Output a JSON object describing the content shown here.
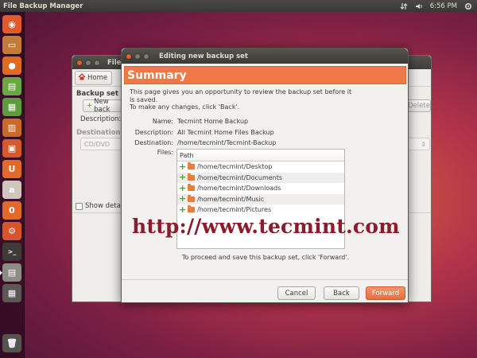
{
  "top_panel": {
    "app_title": "File Backup Manager",
    "time": "6:56 PM"
  },
  "launcher": {
    "items": [
      {
        "name": "dash-icon",
        "glyph": "◉",
        "color": "#e25a2b"
      },
      {
        "name": "files-icon",
        "glyph": "▭",
        "color": "#c47b3a"
      },
      {
        "name": "firefox-icon",
        "glyph": "●",
        "color": "#e06a1f"
      },
      {
        "name": "writer-icon",
        "glyph": "▤",
        "color": "#6aa744"
      },
      {
        "name": "calc-icon",
        "glyph": "▦",
        "color": "#5c9c3a"
      },
      {
        "name": "impress-icon",
        "glyph": "▥",
        "color": "#c96a2a"
      },
      {
        "name": "software-center-icon",
        "glyph": "▣",
        "color": "#d35a2a"
      },
      {
        "name": "ubuntu-one-icon",
        "glyph": "U",
        "color": "#e2682c"
      },
      {
        "name": "amazon-icon",
        "glyph": "a",
        "color": "#cfc7bd"
      },
      {
        "name": "ubuntu-one-music-icon",
        "glyph": "0",
        "color": "#e2682c"
      },
      {
        "name": "system-settings-icon",
        "glyph": "⚙",
        "color": "#d8552b"
      },
      {
        "name": "terminal-icon",
        "glyph": ">_",
        "color": "#3c3b37"
      },
      {
        "name": "backup-manager-icon",
        "glyph": "▤",
        "color": "#8e8a84"
      },
      {
        "name": "workspace-switcher-icon",
        "glyph": "▦",
        "color": "#5b5855"
      },
      {
        "name": "trash-icon",
        "glyph": "🗑",
        "color": "#55534f"
      }
    ]
  },
  "bg_window": {
    "title": "File",
    "home_label": "Home",
    "backup_set_label": "Backup set",
    "new_backup_label": "New back",
    "description_label": "Description:",
    "delete_label": "Delete",
    "destination_label": "Destination",
    "destination_value": "CD/DVD",
    "show_details_label": "Show detail"
  },
  "dialog": {
    "title": "Editing new backup set",
    "heading": "Summary",
    "intro_line1": "This page gives you an opportunity to review the backup set before it",
    "intro_line2": "is saved.",
    "intro_line3": "To make any changes, click 'Back'.",
    "name_label": "Name:",
    "name_value": "Tecmint Home Backup",
    "description_label": "Description:",
    "description_value": "All Tecmint Home Files Backup",
    "destination_label": "Destination:",
    "destination_value": "/home/tecmint/Tecmint-Backup",
    "files_label": "Files:",
    "files_header": "Path",
    "files": [
      "/home/tecmint/Desktop",
      "/home/tecmint/Documents",
      "/home/tecmint/Downloads",
      "/home/tecmint/Music",
      "/home/tecmint/Pictures"
    ],
    "watermark": "http://www.tecmint.com",
    "proceed_text": "To proceed and save this backup set, click 'Forward'.",
    "cancel_label": "Cancel",
    "back_label": "Back",
    "forward_label": "Forward"
  },
  "colors": {
    "accent": "#f07846",
    "watermark": "#8b1c2b"
  }
}
